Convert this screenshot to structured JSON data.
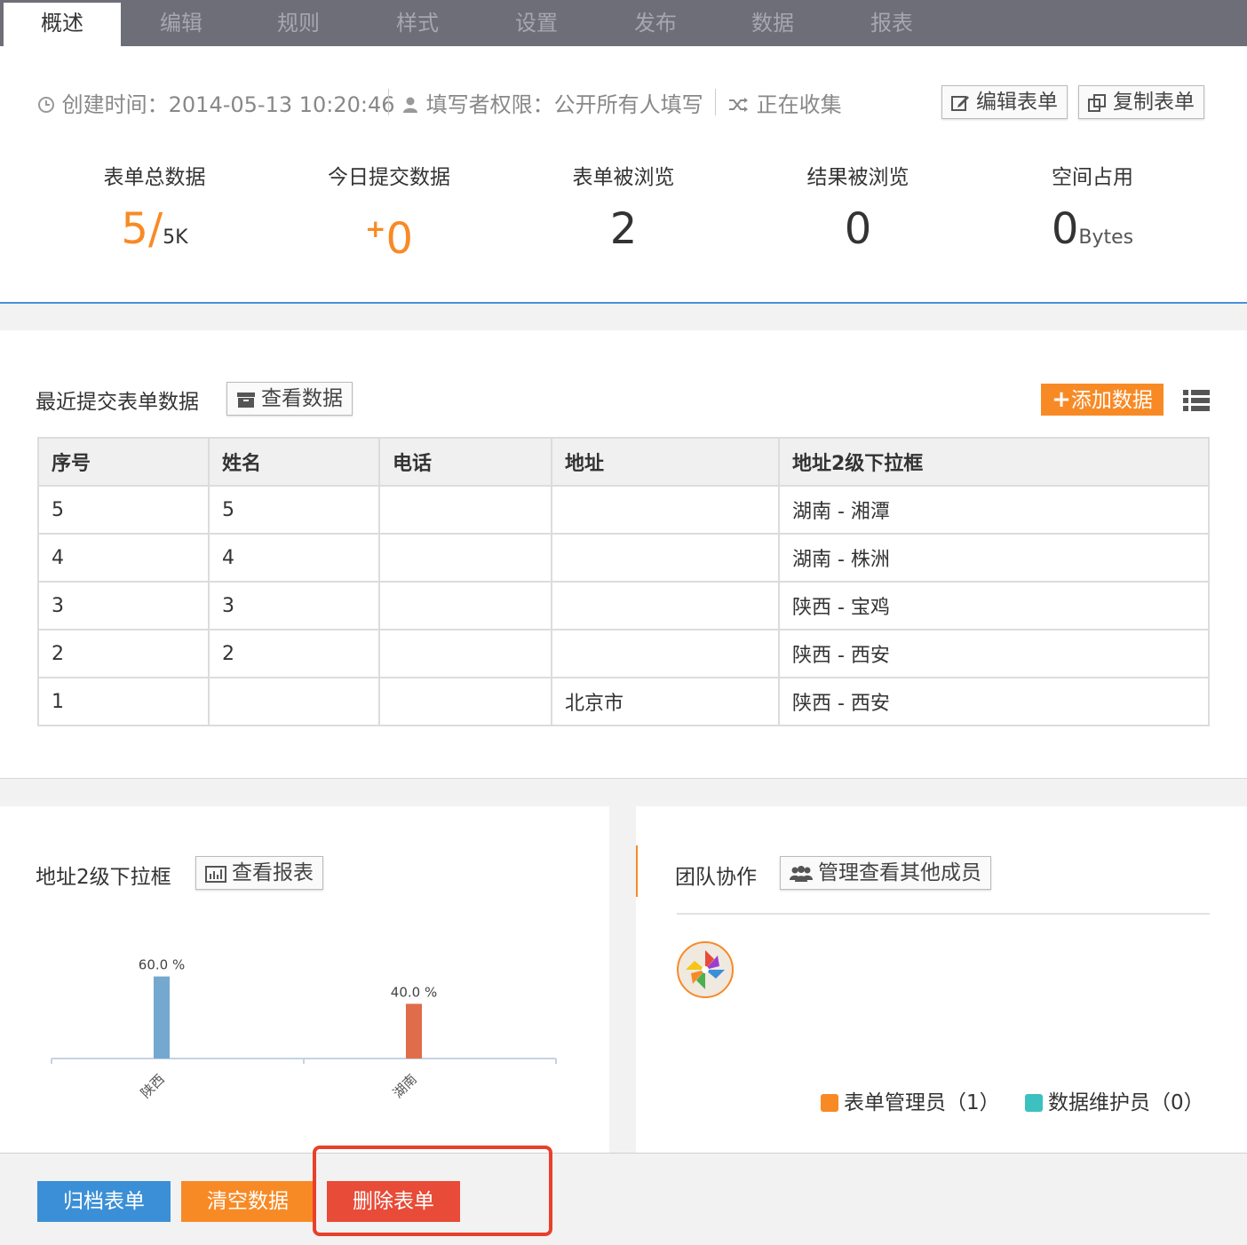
{
  "nav": {
    "tabs": [
      {
        "label": "概述",
        "active": true
      },
      {
        "label": "编辑"
      },
      {
        "label": "规则"
      },
      {
        "label": "样式"
      },
      {
        "label": "设置"
      },
      {
        "label": "发布"
      },
      {
        "label": "数据"
      },
      {
        "label": "报表"
      }
    ]
  },
  "info": {
    "created": "创建时间：2014-05-13 10:20:46",
    "permission": "填写者权限：公开所有人填写",
    "status": "正在收集",
    "edit_btn": "编辑表单",
    "copy_btn": "复制表单"
  },
  "stats": {
    "total_label": "表单总数据",
    "total_value": "5/",
    "total_limit": "5K",
    "today_label": "今日提交数据",
    "today_value": "0",
    "views_label": "表单被浏览",
    "views_value": "2",
    "result_label": "结果被浏览",
    "result_value": "0",
    "space_label": "空间占用",
    "space_value": "0",
    "space_unit": "Bytes"
  },
  "recent": {
    "title": "最近提交表单数据",
    "view_btn": "查看数据",
    "add_btn": "添加数据",
    "headers": [
      "序号",
      "姓名",
      "电话",
      "地址",
      "地址2级下拉框"
    ],
    "rows": [
      [
        "5",
        "5",
        "",
        "",
        "湖南 - 湘潭"
      ],
      [
        "4",
        "4",
        "",
        "",
        "湖南 - 株洲"
      ],
      [
        "3",
        "3",
        "",
        "",
        "陕西 - 宝鸡"
      ],
      [
        "2",
        "2",
        "",
        "",
        "陕西 - 西安"
      ],
      [
        "1",
        "",
        "",
        "北京市",
        "陕西 - 西安"
      ]
    ]
  },
  "report": {
    "title": "地址2级下拉框",
    "view_btn": "查看报表"
  },
  "chart_data": {
    "type": "bar",
    "categories": [
      "陕西",
      "湖南"
    ],
    "values": [
      60.0,
      40.0
    ],
    "labels": [
      "60.0 %",
      "40.0 %"
    ],
    "colors": [
      "#74a8cf",
      "#df6d4a"
    ],
    "ylim": [
      0,
      100
    ]
  },
  "team": {
    "title": "团队协作",
    "manage_btn": "管理查看其他成员",
    "legend": [
      {
        "label": "表单管理员（1）",
        "color": "#f88a26"
      },
      {
        "label": "数据维护员（0）",
        "color": "#3cc0c0"
      }
    ]
  },
  "actions": {
    "archive": "归档表单",
    "clear": "清空数据",
    "delete": "删除表单",
    "archive_color": "#3b8fd6",
    "clear_color": "#f88a26",
    "delete_color": "#e84b37"
  }
}
